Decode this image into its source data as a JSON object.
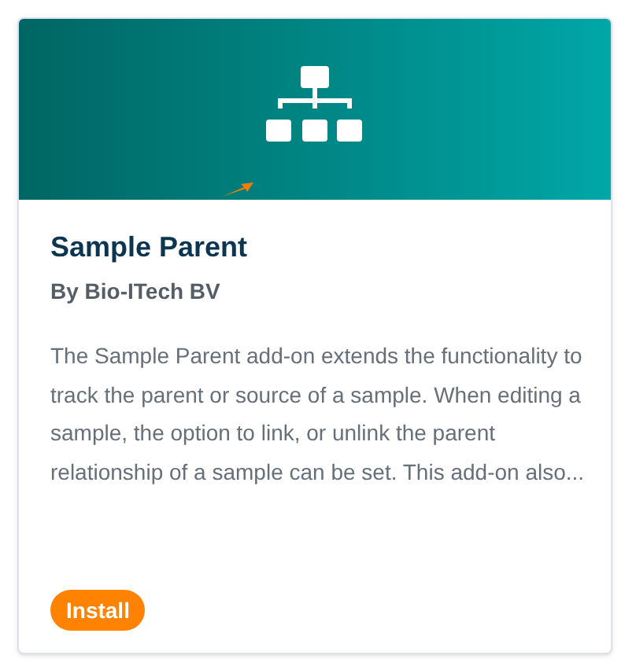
{
  "card": {
    "title": "Sample Parent",
    "author": "By Bio-ITech BV",
    "description": "The Sample Parent add-on extends the functionality to track the parent or source of a sample. When editing a sample, the option to link, or unlink the parent relationship of a sample can be set. This add-on also...",
    "button": "Install"
  }
}
